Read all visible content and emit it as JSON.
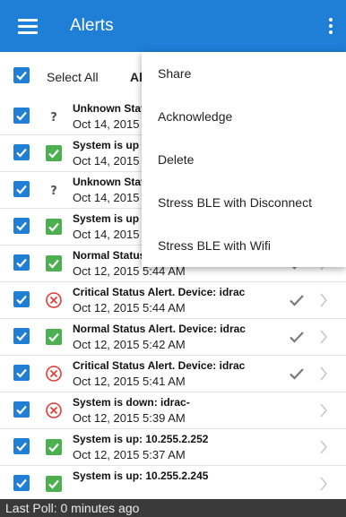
{
  "appbar": {
    "title": "Alerts",
    "menu_icon": "hamburger-icon",
    "overflow_icon": "more-vertical-icon"
  },
  "select_bar": {
    "select_all_label": "Select All",
    "tab_label": "All",
    "checked": true
  },
  "alerts": [
    {
      "title": "Unknown Status",
      "date": "Oct 14, 2015",
      "status": "unknown",
      "checked": true,
      "acknowledged": false
    },
    {
      "title": "System is up",
      "date": "Oct 14, 2015",
      "status": "ok",
      "checked": true,
      "acknowledged": false
    },
    {
      "title": "Unknown Status",
      "date": "Oct 14, 2015",
      "status": "unknown",
      "checked": true,
      "acknowledged": false
    },
    {
      "title": "System is up",
      "date": "Oct 14, 2015",
      "status": "ok",
      "checked": true,
      "acknowledged": false
    },
    {
      "title": "Normal Status",
      "date": "Oct 12, 2015 5:44 AM",
      "status": "ok",
      "checked": true,
      "acknowledged": true
    },
    {
      "title": "Critical Status Alert. Device: idrac",
      "date": "Oct 12, 2015 5:44 AM",
      "status": "critical",
      "checked": true,
      "acknowledged": true
    },
    {
      "title": "Normal Status Alert. Device: idrac",
      "date": "Oct 12, 2015 5:42 AM",
      "status": "ok",
      "checked": true,
      "acknowledged": true
    },
    {
      "title": "Critical Status Alert. Device: idrac",
      "date": "Oct 12, 2015 5:41 AM",
      "status": "critical",
      "checked": true,
      "acknowledged": true
    },
    {
      "title": "System is down: idrac-",
      "date": "Oct 12, 2015 5:39 AM",
      "status": "critical",
      "checked": true,
      "acknowledged": false
    },
    {
      "title": "System is up: 10.255.2.252",
      "date": "Oct 12, 2015 5:37 AM",
      "status": "ok",
      "checked": true,
      "acknowledged": false
    },
    {
      "title": "System is up: 10.255.2.245",
      "date": "",
      "status": "ok",
      "checked": true,
      "acknowledged": false
    }
  ],
  "overflow_menu": [
    {
      "label": "Share"
    },
    {
      "label": "Acknowledge"
    },
    {
      "label": "Delete"
    },
    {
      "label": "Stress BLE with Disconnect"
    },
    {
      "label": "Stress BLE with Wifi"
    }
  ],
  "footer": {
    "last_poll": "Last Poll: 0 minutes ago"
  },
  "colors": {
    "accent": "#1f7ed6",
    "ok": "#4caf50",
    "critical": "#e53935",
    "footer_bg": "#3a3a3a"
  }
}
